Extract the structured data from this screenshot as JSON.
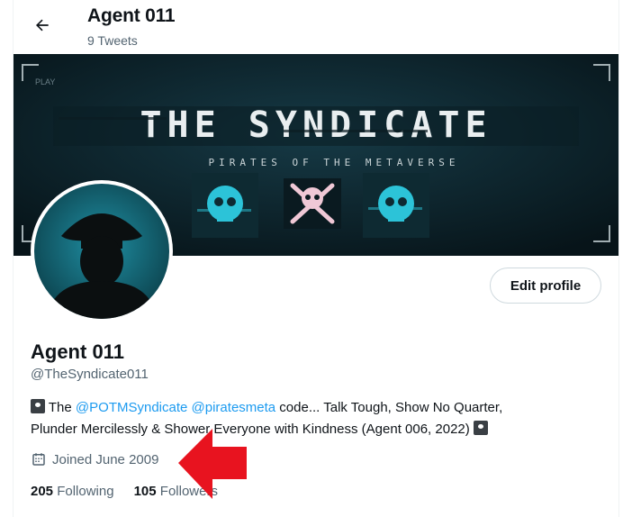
{
  "header": {
    "title": "Agent 011",
    "tweet_count": "9 Tweets"
  },
  "banner": {
    "title": "THE SYNDICATE",
    "subtitle": "PIRATES OF THE METAVERSE",
    "play_label": "PLAY"
  },
  "profile": {
    "name": "Agent 011",
    "handle": "@TheSyndicate011",
    "edit_label": "Edit profile",
    "bio": {
      "prefix": " The ",
      "mention1": "@POTMSyndicate",
      "mention2": "@piratesmeta",
      "line1_rest": " code... Talk Tough, Show No Quarter,",
      "line2": "Plunder Mercilessly & Shower Everyone with Kindness (Agent 006, 2022) "
    },
    "joined": "Joined June 2009",
    "following_count": "205",
    "following_label": "Following",
    "followers_count": "105",
    "followers_label": "Followers"
  },
  "colors": {
    "accent": "#1d9bf0",
    "muted": "#536471",
    "arrow": "#e8131f"
  }
}
